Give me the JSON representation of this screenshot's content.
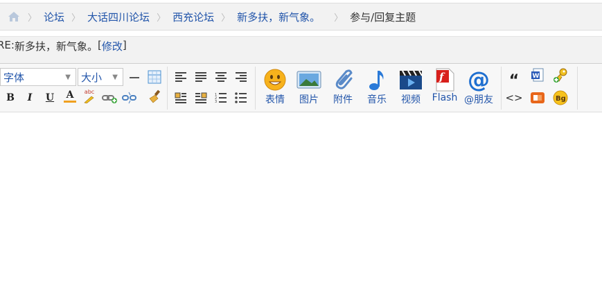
{
  "breadcrumb": {
    "items": [
      "论坛",
      "大话四川论坛",
      "西充论坛",
      "新多扶，新气象。"
    ],
    "current": "参与/回复主题"
  },
  "subject": {
    "prefix": "RE: ",
    "title": "新多扶，新气象。",
    "edit_open": " [",
    "edit_label": "修改",
    "edit_close": "]"
  },
  "toolbar": {
    "font_label": "字体",
    "size_label": "大小",
    "bold": "B",
    "italic": "I",
    "underline": "U",
    "color": "A",
    "spell_icon_text": "abc",
    "buttons": [
      {
        "label": "表情",
        "icon": "smiley-icon"
      },
      {
        "label": "图片",
        "icon": "image-icon"
      },
      {
        "label": "附件",
        "icon": "paperclip-icon"
      },
      {
        "label": "音乐",
        "icon": "music-note-icon"
      },
      {
        "label": "视频",
        "icon": "clapperboard-icon"
      },
      {
        "label": "Flash",
        "icon": "flash-icon"
      },
      {
        "label": "@朋友",
        "icon": "at-icon"
      }
    ],
    "quote_glyph": "“",
    "code_glyph": "<>",
    "bg_label": "Bg",
    "colors": {
      "link": "#2255aa",
      "accent_orange": "#f0a020",
      "flash_red": "#d8201c",
      "at_blue": "#1f6fd0"
    }
  }
}
